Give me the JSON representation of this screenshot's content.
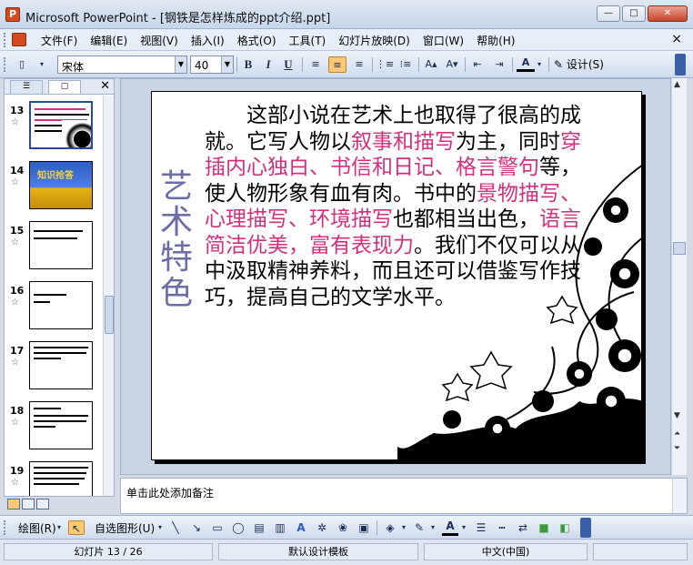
{
  "window": {
    "title": "Microsoft PowerPoint - [钢铁是怎样炼成的ppt介绍.ppt]",
    "minimize": "—",
    "maximize": "□",
    "close": "✕"
  },
  "menu": {
    "items": [
      "文件(F)",
      "编辑(E)",
      "视图(V)",
      "插入(I)",
      "格式(O)",
      "工具(T)",
      "幻灯片放映(D)",
      "窗口(W)",
      "帮助(H)"
    ],
    "close": "×"
  },
  "toolbar": {
    "font_name": "宋体",
    "font_size": "40",
    "bold": "B",
    "italic": "I",
    "underline": "U",
    "design_label": "设计(S)"
  },
  "thumbnails": [
    {
      "num": "13",
      "selected": true
    },
    {
      "num": "14",
      "title": "知识抢答"
    },
    {
      "num": "15"
    },
    {
      "num": "16"
    },
    {
      "num": "17"
    },
    {
      "num": "18"
    },
    {
      "num": "19"
    }
  ],
  "slide": {
    "vertical_title": [
      "艺",
      "术",
      "特",
      "色"
    ],
    "body": {
      "p1": "　　这部小说在艺术上也取得了很高的成就。它写人物以",
      "h1": "叙事和描写",
      "p2": "为主，同时",
      "h2": "穿插内心独白、书信和日记、格言警句",
      "p3": "等，使人物形象有血有肉。书中的",
      "h3": "景物描写、心理描写、环境描写",
      "p4": "也都相当出色，",
      "h4": "语言简洁优美，富有表现力",
      "p5": "。我们不仅可以从中汲取精神养料，而且还可以借鉴写作技巧，提高自己的文学水平。"
    },
    "highlight_color": "#d0307f",
    "title_color": "#6c6da6"
  },
  "notes": {
    "placeholder": "单击此处添加备注"
  },
  "drawbar": {
    "draw_label": "绘图(R)",
    "autoshape_label": "自选图形(U)"
  },
  "status": {
    "slide_info": "幻灯片 13 / 26",
    "template": "默认设计模板",
    "language": "中文(中国)"
  }
}
